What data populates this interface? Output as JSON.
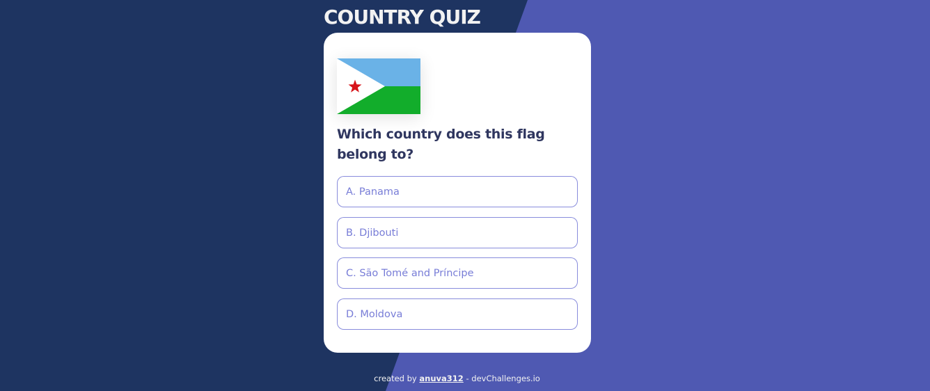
{
  "app": {
    "title": "COUNTRY QUIZ"
  },
  "quiz": {
    "flag_icon": "djibouti-flag",
    "question": "Which country does this flag belong to?",
    "options": [
      {
        "label": "A. Panama"
      },
      {
        "label": "B. Djibouti"
      },
      {
        "label": "C. São Tomé and Príncipe"
      },
      {
        "label": "D. Moldova"
      }
    ]
  },
  "footer": {
    "prefix": "created by",
    "username": "anuva312",
    "separator": "-",
    "site": "devChallenges.io"
  },
  "colors": {
    "background_dark": "#1e3461",
    "background_accent": "#4f59b2",
    "card": "#ffffff",
    "question_text": "#2f365f",
    "option_accent": "#6066d0"
  }
}
